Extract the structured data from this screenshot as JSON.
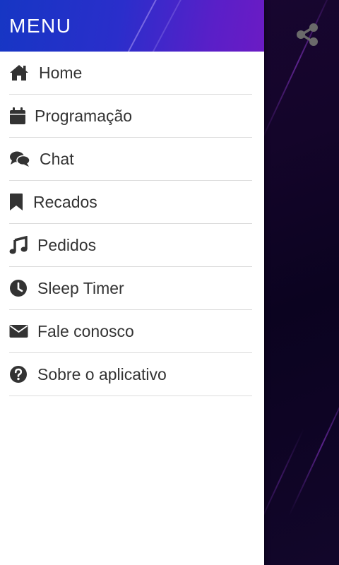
{
  "drawer": {
    "title": "MENU",
    "items": [
      {
        "label": "Home",
        "icon": "home-icon"
      },
      {
        "label": "Programação",
        "icon": "calendar-icon"
      },
      {
        "label": "Chat",
        "icon": "chat-bubbles-icon"
      },
      {
        "label": "Recados",
        "icon": "bookmark-icon"
      },
      {
        "label": "Pedidos",
        "icon": "music-note-icon"
      },
      {
        "label": "Sleep Timer",
        "icon": "clock-icon"
      },
      {
        "label": "Fale conosco",
        "icon": "envelope-icon"
      },
      {
        "label": "Sobre o aplicativo",
        "icon": "help-circle-icon"
      }
    ]
  },
  "toolbar": {
    "share_icon": "share-icon"
  },
  "colors": {
    "header_start": "#1636c4",
    "header_end": "#6b1bc4",
    "background": "#14052a",
    "text": "#333333",
    "icon": "#333333"
  }
}
